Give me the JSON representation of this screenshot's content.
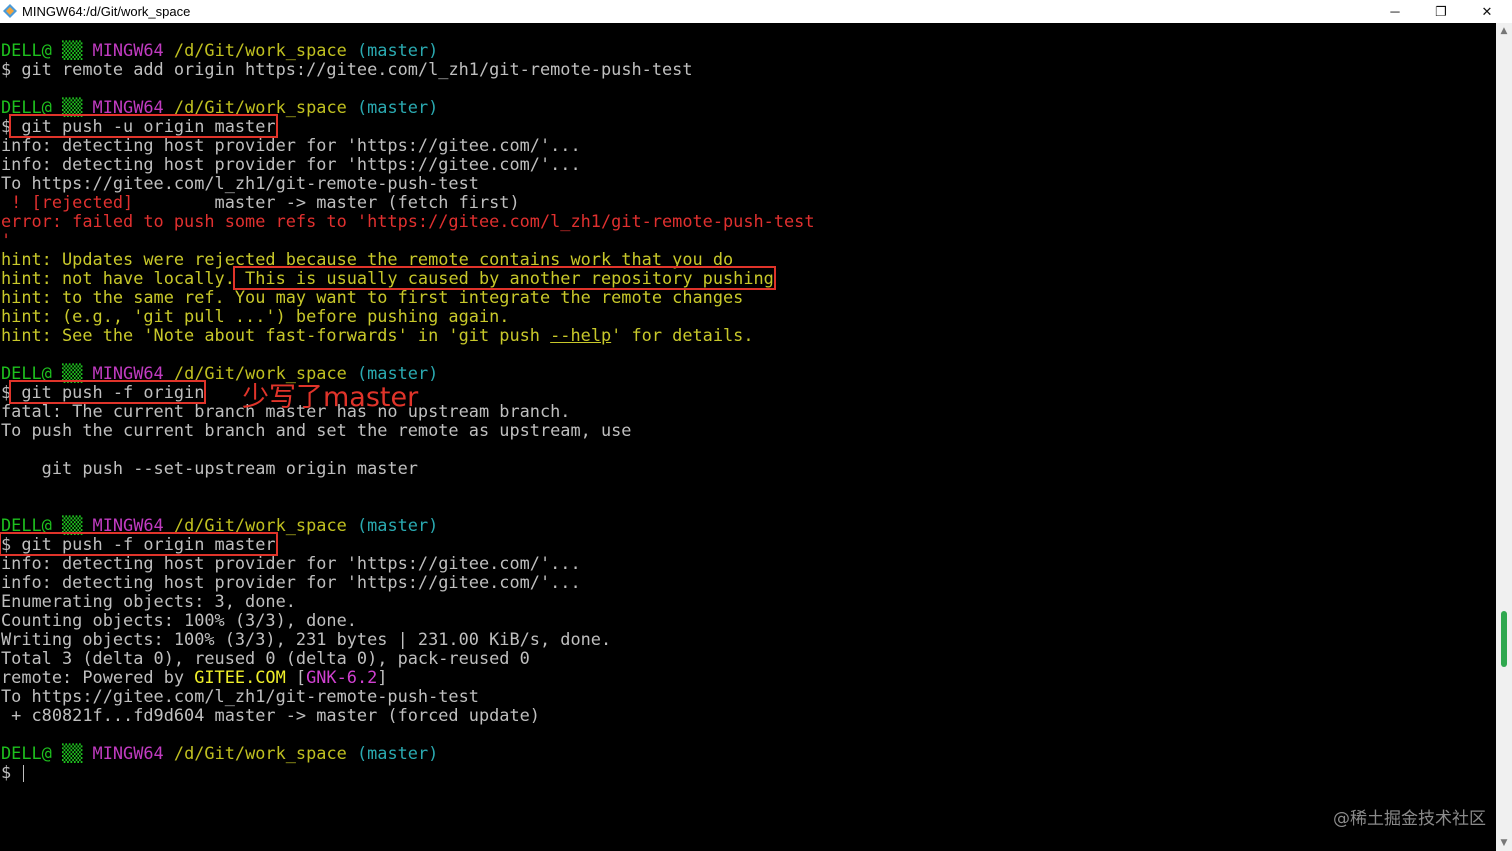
{
  "window": {
    "title": "MINGW64:/d/Git/work_space",
    "minimize_glyph": "─",
    "maximize_glyph": "❐",
    "close_glyph": "✕",
    "icon": "git-bash-icon"
  },
  "prompt": {
    "user": "DELL@",
    "grid": "▒▒",
    "host": "MINGW64",
    "path": "/d/Git/work_space",
    "branch": "(master)",
    "symbol": "$"
  },
  "block1": {
    "command": " git remote add origin https://gitee.com/l_zh1/git-remote-push-test"
  },
  "block2": {
    "command": " git push -u origin master",
    "info1": "info: detecting host provider for 'https://gitee.com/'...",
    "info2": "info: detecting host provider for 'https://gitee.com/'...",
    "to": "To https://gitee.com/l_zh1/git-remote-push-test",
    "rejected_tag": " ! [rejected]",
    "rejected_rest": "        master -> master (fetch first)",
    "error": "error: failed to push some refs to 'https://gitee.com/l_zh1/git-remote-push-test",
    "error_tail": "'",
    "hint1": "hint: Updates were rejected because the remote contains work that you do",
    "hint2_a": "hint: not have locally.",
    "hint2_b": " This is usually caused by another repository pushing",
    "hint3": "hint: to the same ref. You may want to first integrate the remote changes",
    "hint4": "hint: (e.g., 'git pull ...') before pushing again.",
    "hint5_a": "hint: See the 'Note about fast-forwards' in 'git push ",
    "hint5_link": "--help",
    "hint5_b": "' for details."
  },
  "block3": {
    "command": " git push -f origin",
    "annotation": "少写了master",
    "fatal": "fatal: The current branch master has no upstream branch.",
    "to_push": "To push the current branch and set the remote as upstream, use",
    "suggestion": "    git push --set-upstream origin master"
  },
  "block4": {
    "command": " git push -f origin master",
    "info1": "info: detecting host provider for 'https://gitee.com/'...",
    "info2": "info: detecting host provider for 'https://gitee.com/'...",
    "enum": "Enumerating objects: 3, done.",
    "count": "Counting objects: 100% (3/3), done.",
    "write": "Writing objects: 100% (3/3), 231 bytes | 231.00 KiB/s, done.",
    "total": "Total 3 (delta 0), reused 0 (delta 0), pack-reused 0",
    "remote_a": "remote: Powered by ",
    "remote_gitee": "GITEE.COM",
    "remote_b": " [",
    "remote_gnk": "GNK-6.2",
    "remote_c": "]",
    "to": "To https://gitee.com/l_zh1/git-remote-push-test",
    "forced": " + c80821f...fd9d604 master -> master (forced update)"
  },
  "watermark": "@稀土掘金技术社区",
  "scrollbar": {
    "up_glyph": "▲",
    "down_glyph": "▼"
  },
  "colors": {
    "prompt_user": "#1ec01e",
    "prompt_host": "#c03bc0",
    "prompt_path": "#c0c020",
    "prompt_branch": "#2aa9b0",
    "error": "#e0302f",
    "hint": "#c8c82a",
    "highlight_box": "#e0342a"
  }
}
